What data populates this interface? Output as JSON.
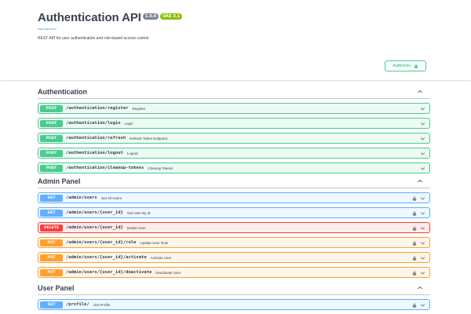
{
  "info": {
    "title": "Authentication API",
    "version_badge": "1.0.0",
    "oas_badge": "OAS 3.1",
    "spec_link": "/openapi.json",
    "description": "REST API for user authentication and role-based access control"
  },
  "authorize": {
    "label": "Authorize"
  },
  "sections": [
    {
      "title": "Authentication",
      "ops": [
        {
          "method": "POST",
          "path": "/authentication/register",
          "summary": "Register"
        },
        {
          "method": "POST",
          "path": "/authentication/login",
          "summary": "Login"
        },
        {
          "method": "POST",
          "path": "/authentication/refresh",
          "summary": "Refresh Token Endpoint"
        },
        {
          "method": "POST",
          "path": "/authentication/logout",
          "summary": "Logout"
        },
        {
          "method": "POST",
          "path": "/authentication/cleanup-tokens",
          "summary": "Cleanup Tokens"
        }
      ]
    },
    {
      "title": "Admin Panel",
      "ops": [
        {
          "method": "GET",
          "path": "/admin/users",
          "summary": "Get All Users"
        },
        {
          "method": "GET",
          "path": "/admin/users/{user_id}",
          "summary": "Get User By Id"
        },
        {
          "method": "DELETE",
          "path": "/admin/users/{user_id}",
          "summary": "Delete User"
        },
        {
          "method": "PUT",
          "path": "/admin/users/{user_id}/role",
          "summary": "Update User Role"
        },
        {
          "method": "PUT",
          "path": "/admin/users/{user_id}/activate",
          "summary": "Activate User"
        },
        {
          "method": "PUT",
          "path": "/admin/users/{user_id}/deactivate",
          "summary": "Deactivate User"
        }
      ]
    },
    {
      "title": "User Panel",
      "ops": [
        {
          "method": "GET",
          "path": "/profile/",
          "summary": "Get Profile"
        }
      ]
    }
  ],
  "colors": {
    "post": "#49cc90",
    "get": "#61affe",
    "delete": "#f93e3e",
    "put": "#fca130",
    "text": "#3b4151"
  }
}
